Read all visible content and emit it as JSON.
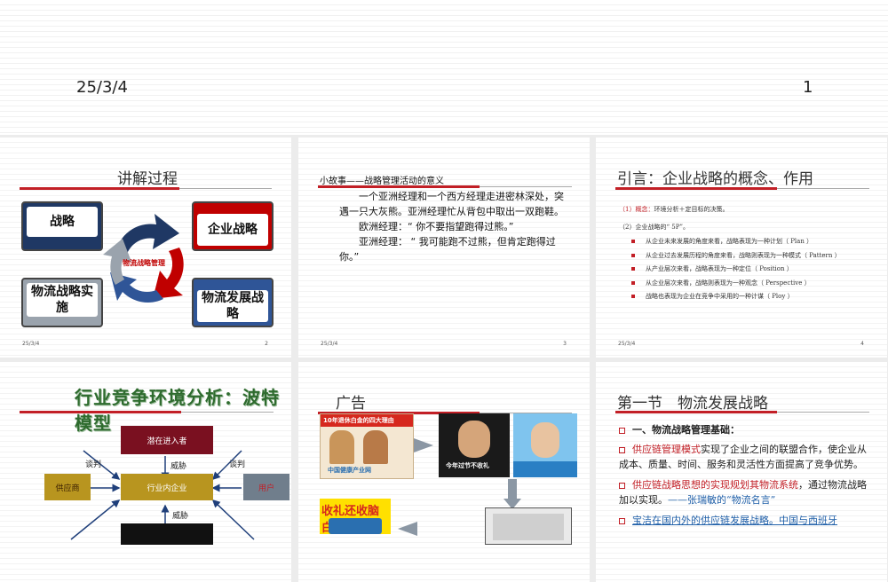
{
  "top": {
    "date": "25/3/4",
    "page": "1"
  },
  "slides": [
    {
      "date": "25/3/4",
      "page": "2",
      "title": "讲解过程",
      "cards": {
        "tl": "战略",
        "tr": "企业战略",
        "bl": "物流战略实施",
        "br": "物流发展战略"
      },
      "center": "物流战略管理"
    },
    {
      "date": "25/3/4",
      "page": "3",
      "title": "小故事——战略管理活动的意义",
      "paragraphs": [
        "一个亚洲经理和一个西方经理走进密林深处，突遇一只大灰熊。亚洲经理忙从背包中取出一双跑鞋。",
        "欧洲经理：“ 你不要指望跑得过熊。”",
        "亚洲经理：  “ 我可能跑不过熊，但肯定跑得过你。”"
      ]
    },
    {
      "date": "25/3/4",
      "page": "4",
      "title": "引言：企业战略的概念、作用",
      "concept_num": "（1）",
      "concept_label": "概念：",
      "concept_text": "环境分析＋定目标的决策。",
      "fivep": "（2）企业战略的“ 5P”。",
      "items": [
        "从企业未来发展的角度来看，战略表现为一种计划（ Plan ）",
        "从企业过去发展历程的角度来看，战略则表现为一种模式（ Pattern ）",
        "从产业层次来看，战略表现为一种定位（ Position ）",
        "从企业层次来看，战略则表现为一种观念（ Perspective ）",
        "战略也表现为企业在竞争中采用的一种计谋（ Ploy ）"
      ]
    },
    {
      "title": "行业竞争环境分析：波特模型",
      "boxes": {
        "top": "潜在进入者",
        "left": "供应商",
        "center": "行业内企业",
        "right": "用户"
      },
      "labels": {
        "neg_left": "谈判",
        "threat_top": "威胁",
        "neg_right": "谈判",
        "threat_bottom": "威胁"
      }
    },
    {
      "title": "广告",
      "ad_texts": {
        "a1": "10年退休白金的四大理由",
        "a1_sub": "中国健康产业网",
        "a2": "今年过节不收礼",
        "a3": "收礼还收脑白金"
      }
    },
    {
      "title": "第一节　物流发展战略",
      "bullets": [
        "一、物流战略管理基础：",
        "供应链管理模式实现了企业之间的联盟合作，使企业从成本、质量、时间、服务和灵活性方面提高了竞争优势。",
        "供应链战略思想的实现规划其物流系统，通过物流战略加以实现。——张瑞敏的“物流名言”",
        "宝洁在国内外的供应链发展战略。中国与西班牙"
      ]
    }
  ]
}
